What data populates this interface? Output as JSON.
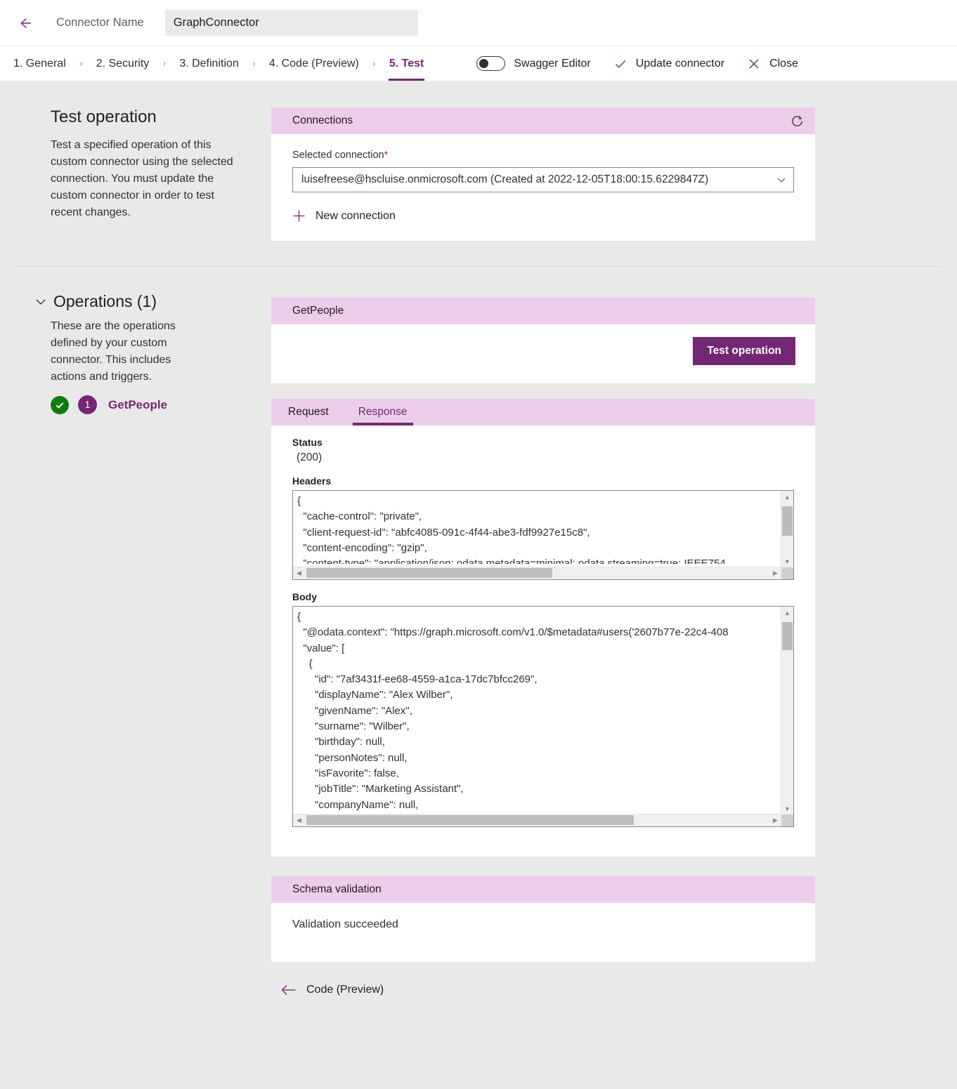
{
  "topbar": {
    "back_icon": "back-arrow-icon",
    "connector_name_label": "Connector Name",
    "connector_name_value": "GraphConnector",
    "connector_name_placeholder": "Connector Name"
  },
  "steps": [
    {
      "label": "1. General",
      "active": false
    },
    {
      "label": "2. Security",
      "active": false
    },
    {
      "label": "3. Definition",
      "active": false
    },
    {
      "label": "4. Code (Preview)",
      "active": false
    },
    {
      "label": "5. Test",
      "active": true
    }
  ],
  "chevron": "›",
  "commands": {
    "swagger_editor_label": "Swagger Editor",
    "swagger_editor_on": false,
    "update_connector_label": "Update connector",
    "close_label": "Close"
  },
  "test_section": {
    "title": "Test operation",
    "description": "Test a specified operation of this custom connector using the selected connection. You must update the custom connector in order to test recent changes."
  },
  "connections": {
    "header": "Connections",
    "refresh_icon": "refresh-icon",
    "selected_connection_label": "Selected connection",
    "required_marker": "*",
    "selected_connection_value": "luisefreese@hscluise.onmicrosoft.com (Created at 2022-12-05T18:00:15.6229847Z)",
    "new_connection_label": "New connection"
  },
  "operations": {
    "title": "Operations (1)",
    "description": "These are the operations defined by your custom connector. This includes actions and triggers.",
    "items": [
      {
        "status": "succeeded",
        "number": "1",
        "name": "GetPeople"
      }
    ]
  },
  "operation_card": {
    "header": "GetPeople",
    "test_button_label": "Test operation"
  },
  "tabs": [
    {
      "label": "Request",
      "active": false
    },
    {
      "label": "Response",
      "active": true
    }
  ],
  "response": {
    "status_label": "Status",
    "status_value": "(200)",
    "headers_label": "Headers",
    "headers_value": "{\n  \"cache-control\": \"private\",\n  \"client-request-id\": \"abfc4085-091c-4f44-abe3-fdf9927e15c8\",\n  \"content-encoding\": \"gzip\",\n  \"content-type\": \"application/json; odata.metadata=minimal; odata.streaming=true; IEEE754",
    "body_label": "Body",
    "body_value": "{\n  \"@odata.context\": \"https://graph.microsoft.com/v1.0/$metadata#users('2607b77e-22c4-408\n  \"value\": [\n    {\n      \"id\": \"7af3431f-ee68-4559-a1ca-17dc7bfcc269\",\n      \"displayName\": \"Alex Wilber\",\n      \"givenName\": \"Alex\",\n      \"surname\": \"Wilber\",\n      \"birthday\": null,\n      \"personNotes\": null,\n      \"isFavorite\": false,\n      \"jobTitle\": \"Marketing Assistant\",\n      \"companyName\": null,\n      \"yomiCompany\": null,"
  },
  "schema_validation": {
    "header": "Schema validation",
    "message": "Validation succeeded"
  },
  "footer": {
    "back_label": "Code (Preview)"
  },
  "colors": {
    "accent": "#742774",
    "panel_header": "#eccdea",
    "page_bg": "#e9e9e9",
    "success": "#107c10",
    "required": "#a4262c"
  }
}
